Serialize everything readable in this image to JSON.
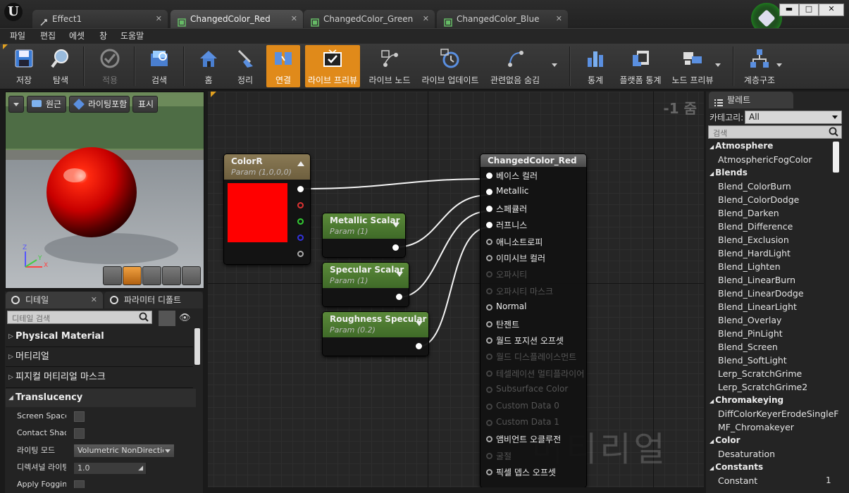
{
  "window": {
    "tabs": [
      {
        "label": "Effect1",
        "active": false
      },
      {
        "label": "ChangedColor_Red",
        "active": true
      },
      {
        "label": "ChangedColor_Green",
        "active": false
      },
      {
        "label": "ChangedColor_Blue",
        "active": false
      }
    ],
    "controls": {
      "minimize": "▬",
      "maximize": "□",
      "close": "✕"
    }
  },
  "menu": [
    "파일",
    "편집",
    "에셋",
    "창",
    "도움말"
  ],
  "toolbar": {
    "buttons": [
      {
        "label": "저장",
        "icon": "save-icon"
      },
      {
        "label": "탐색",
        "icon": "browse-icon"
      },
      {
        "label": "적용",
        "icon": "apply-icon",
        "disabled": true
      },
      {
        "label": "검색",
        "icon": "search-icon"
      },
      {
        "label": "홈",
        "icon": "home-icon"
      },
      {
        "label": "정리",
        "icon": "clean-up-icon"
      },
      {
        "label": "연결",
        "icon": "connectors-icon",
        "active": true
      },
      {
        "label": "라이브 프리뷰",
        "icon": "live-preview-icon",
        "active": true
      },
      {
        "label": "라이브 노드",
        "icon": "live-nodes-icon"
      },
      {
        "label": "라이브 업데이트",
        "icon": "live-update-icon"
      },
      {
        "label": "관련없음 숨김",
        "icon": "hide-unrelated-icon"
      },
      {
        "label": "통계",
        "icon": "stats-icon"
      },
      {
        "label": "플랫폼 통계",
        "icon": "platform-stats-icon"
      },
      {
        "label": "노드 프리뷰",
        "icon": "node-preview-icon"
      },
      {
        "label": "계층구조",
        "icon": "hierarchy-icon"
      }
    ]
  },
  "viewport": {
    "buttons": {
      "perspective": "원근",
      "lit": "라이팅포함",
      "show": "표시"
    },
    "axis": {
      "x": "X",
      "y": "Y",
      "z": "Z"
    }
  },
  "details": {
    "tabs": {
      "details": "디테일",
      "params": "파라미터 디폴트"
    },
    "search_placeholder": "디테일 검색",
    "categories": {
      "physical_material": "Physical Material",
      "material": "머티리얼",
      "physical_material_mask": "피지컬 머티리얼 마스크",
      "translucency": "Translucency"
    },
    "props": {
      "screen_space": "Screen Space Reflections",
      "contact_shadows": "Contact Shadows",
      "lighting_mode": "라이팅 모드",
      "lighting_mode_value": "Volumetric NonDirectional",
      "directional_lighting": "디렉셔널 라이팅 강도",
      "directional_lighting_value": "1.0",
      "apply_fogging": "Apply Fogging"
    }
  },
  "graph": {
    "zoom": "-1 줌",
    "watermark": "머티리얼",
    "color_node": {
      "title": "ColorR",
      "subtitle": "Param (1,0,0,0)",
      "color": "#ff0000"
    },
    "metallic_node": {
      "title": "Metallic Scalar",
      "subtitle": "Param (1)"
    },
    "specular_node": {
      "title": "Specular Scalar",
      "subtitle": "Param (1)"
    },
    "roughness_node": {
      "title": "Roughness Specular",
      "subtitle": "Param (0.2)"
    },
    "result_node": {
      "title": "ChangedColor_Red",
      "pins": [
        {
          "label": "베이스 컬러",
          "enabled": true,
          "connected": true
        },
        {
          "label": "Metallic",
          "enabled": true,
          "connected": true
        },
        {
          "label": "스페큘러",
          "enabled": true,
          "connected": true
        },
        {
          "label": "러프니스",
          "enabled": true,
          "connected": true
        },
        {
          "label": "애니소트로피",
          "enabled": true,
          "connected": false
        },
        {
          "label": "이미시브 컬러",
          "enabled": true,
          "connected": false
        },
        {
          "label": "오파시티",
          "enabled": false,
          "connected": false
        },
        {
          "label": "오파시티 마스크",
          "enabled": false,
          "connected": false
        },
        {
          "label": "Normal",
          "enabled": true,
          "connected": false
        },
        {
          "label": "탄젠트",
          "enabled": true,
          "connected": false
        },
        {
          "label": "월드 포지션 오프셋",
          "enabled": true,
          "connected": false
        },
        {
          "label": "월드 디스플레이스먼트",
          "enabled": false,
          "connected": false
        },
        {
          "label": "테셀레이션 멀티플라이어",
          "enabled": false,
          "connected": false
        },
        {
          "label": "Subsurface Color",
          "enabled": false,
          "connected": false
        },
        {
          "label": "Custom Data 0",
          "enabled": false,
          "connected": false
        },
        {
          "label": "Custom Data 1",
          "enabled": false,
          "connected": false
        },
        {
          "label": "앰비언트 오클루전",
          "enabled": true,
          "connected": false
        },
        {
          "label": "굴절",
          "enabled": false,
          "connected": false
        },
        {
          "label": "픽셀 뎁스 오프셋",
          "enabled": true,
          "connected": false
        }
      ]
    }
  },
  "palette": {
    "tab": "팔레트",
    "category_label": "카테고리:",
    "category_value": "All",
    "search_placeholder": "검색",
    "entries": [
      {
        "type": "cat",
        "label": "Atmosphere"
      },
      {
        "type": "item",
        "label": "AtmosphericFogColor"
      },
      {
        "type": "cat",
        "label": "Blends"
      },
      {
        "type": "item",
        "label": "Blend_ColorBurn"
      },
      {
        "type": "item",
        "label": "Blend_ColorDodge"
      },
      {
        "type": "item",
        "label": "Blend_Darken"
      },
      {
        "type": "item",
        "label": "Blend_Difference"
      },
      {
        "type": "item",
        "label": "Blend_Exclusion"
      },
      {
        "type": "item",
        "label": "Blend_HardLight"
      },
      {
        "type": "item",
        "label": "Blend_Lighten"
      },
      {
        "type": "item",
        "label": "Blend_LinearBurn"
      },
      {
        "type": "item",
        "label": "Blend_LinearDodge"
      },
      {
        "type": "item",
        "label": "Blend_LinearLight"
      },
      {
        "type": "item",
        "label": "Blend_Overlay"
      },
      {
        "type": "item",
        "label": "Blend_PinLight"
      },
      {
        "type": "item",
        "label": "Blend_Screen"
      },
      {
        "type": "item",
        "label": "Blend_SoftLight"
      },
      {
        "type": "item",
        "label": "Lerp_ScratchGrime"
      },
      {
        "type": "item",
        "label": "Lerp_ScratchGrime2"
      },
      {
        "type": "cat",
        "label": "Chromakeying"
      },
      {
        "type": "item",
        "label": "DiffColorKeyerErodeSingleF"
      },
      {
        "type": "item",
        "label": "MF_Chromakeyer"
      },
      {
        "type": "cat",
        "label": "Color"
      },
      {
        "type": "item",
        "label": "Desaturation"
      },
      {
        "type": "cat",
        "label": "Constants"
      },
      {
        "type": "item",
        "label": "Constant",
        "shortcut": "1"
      }
    ]
  }
}
